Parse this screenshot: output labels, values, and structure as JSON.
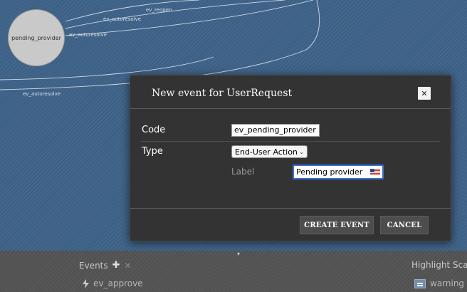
{
  "graph": {
    "state_node_label": "pending_provider",
    "edge_labels": [
      "ev_autoresolve",
      "ev_reopen",
      "ev_autoresolve",
      "ev_autoresolve"
    ]
  },
  "dialog": {
    "title": "New event for UserRequest",
    "close_icon": "close-icon",
    "code_label": "Code",
    "code_value": "ev_pending_provider",
    "type_label": "Type",
    "type_value": "End-User Action",
    "label_caption": "Label",
    "label_value": "Pending provider",
    "language_icon": "us-flag-icon",
    "create_button": "CREATE EVENT",
    "cancel_button": "CANCEL"
  },
  "bottom_panel": {
    "events_title": "Events",
    "events_items": [
      "ev_approve"
    ],
    "highlight_title": "Highlight Scale",
    "highlight_items": [
      "warning"
    ]
  }
}
